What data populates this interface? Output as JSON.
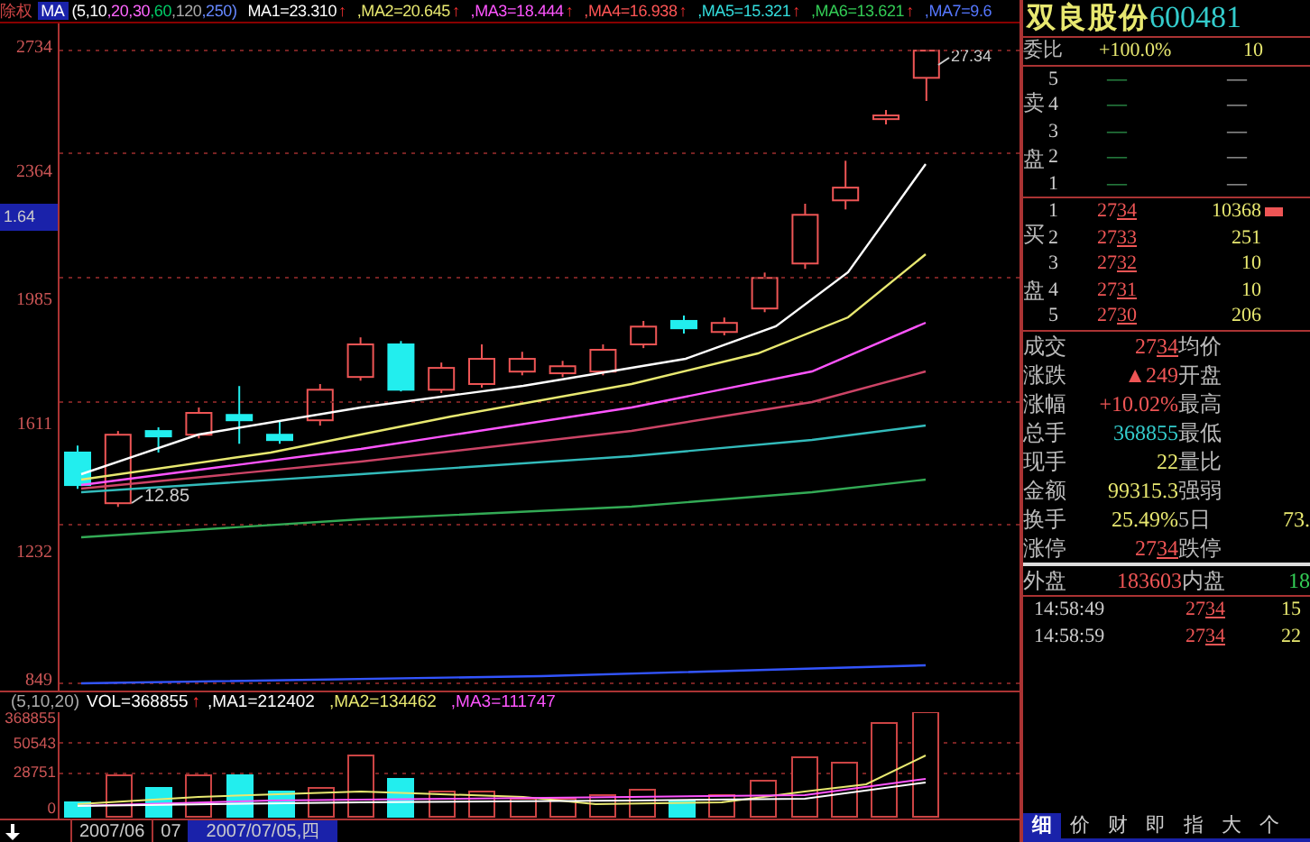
{
  "indicator_bar": {
    "label": "除权",
    "ma_title": "MA",
    "ma_periods": [
      {
        "text": "(5",
        "color": "#ffffff"
      },
      {
        "text": ",10",
        "color": "#ffffff"
      },
      {
        "text": ",20",
        "color": "#ff66ff"
      },
      {
        "text": ",30",
        "color": "#ff66ff"
      },
      {
        "text": ",60",
        "color": "#00cc66"
      },
      {
        "text": ",120",
        "color": "#aaaaaa"
      },
      {
        "text": ",250)",
        "color": "#6688ff"
      }
    ],
    "items": [
      {
        "text": "MA1=23.310",
        "arrow": "↑",
        "color": "#ffffff"
      },
      {
        "text": ",MA2=20.645",
        "arrow": "↑",
        "color": "#e8e870"
      },
      {
        "text": ",MA3=18.444",
        "arrow": "↑",
        "color": "#ff55ff"
      },
      {
        "text": ",MA4=16.938",
        "arrow": "↑",
        "color": "#ff5555"
      },
      {
        "text": ",MA5=15.321",
        "arrow": "↑",
        "color": "#33dddd"
      },
      {
        "text": ",MA6=13.621",
        "arrow": "↑",
        "color": "#33cc55"
      },
      {
        "text": ",MA7=9.6",
        "color": "#5577ff"
      }
    ]
  },
  "price_axis": {
    "cursor_value": "1.64"
  },
  "price_chart": {
    "high_label": "27.34",
    "low_label": "12.85",
    "chart_data": {
      "type": "candlestick",
      "ylim": [
        828,
        2815
      ],
      "yticks": [
        2734,
        2364,
        1985,
        1611,
        1232,
        849
      ],
      "ohlc": [
        [
          1537,
          1558,
          1429,
          1440
        ],
        [
          1386,
          1601,
          1375,
          1590
        ],
        [
          1601,
          1612,
          1537,
          1585
        ],
        [
          1590,
          1671,
          1579,
          1655
        ],
        [
          1649,
          1735,
          1563,
          1633
        ],
        [
          1590,
          1633,
          1563,
          1574
        ],
        [
          1633,
          1741,
          1617,
          1724
        ],
        [
          1762,
          1880,
          1751,
          1859
        ],
        [
          1859,
          1869,
          1719,
          1724
        ],
        [
          1724,
          1805,
          1714,
          1789
        ],
        [
          1741,
          1859,
          1730,
          1816
        ],
        [
          1778,
          1837,
          1767,
          1816
        ],
        [
          1773,
          1810,
          1762,
          1794
        ],
        [
          1778,
          1859,
          1767,
          1843
        ],
        [
          1859,
          1929,
          1848,
          1912
        ],
        [
          1929,
          1945,
          1891,
          1907
        ],
        [
          1896,
          1939,
          1886,
          1923
        ],
        [
          1966,
          2073,
          1955,
          2057
        ],
        [
          2100,
          2278,
          2084,
          2245
        ],
        [
          2288,
          2406,
          2261,
          2326
        ],
        [
          2530,
          2557,
          2514,
          2541
        ],
        [
          2653,
          2734,
          2584,
          2734
        ]
      ]
    }
  },
  "volume_bar": {
    "params": "(5,10,20)",
    "items": [
      {
        "text": "VOL=368855",
        "arrow": "↑",
        "color": "#ffffff"
      },
      {
        "text": ",MA1=212402",
        "color": "#ffffff"
      },
      {
        "text": ",MA2=134462",
        "color": "#e8e870"
      },
      {
        "text": ",MA3=111747",
        "color": "#ff55ff"
      }
    ]
  },
  "volume_axis": [
    "368855",
    "50543",
    "28751",
    "0"
  ],
  "date_bar": {
    "dates": [
      "2007/06",
      "07"
    ],
    "cursor_date": "2007/07/05,四"
  },
  "quote": {
    "name": "双良股份",
    "code": "600481",
    "ratio": {
      "label": "委比",
      "value": "+100.0%",
      "extra": "10"
    },
    "sell": {
      "label": "卖盘",
      "rows": [
        {
          "rank": "5",
          "price": "—",
          "volume": "—"
        },
        {
          "rank": "4",
          "price": "—",
          "volume": "—"
        },
        {
          "rank": "3",
          "price": "—",
          "volume": "—"
        },
        {
          "rank": "2",
          "price": "—",
          "volume": "—"
        },
        {
          "rank": "1",
          "price": "—",
          "volume": "—"
        }
      ]
    },
    "buy": {
      "label": "买盘",
      "rows": [
        {
          "rank": "1",
          "price": "2734",
          "volume": "10368",
          "highlight": true
        },
        {
          "rank": "2",
          "price": "2733",
          "volume": "251",
          "highlight": false
        },
        {
          "rank": "3",
          "price": "2732",
          "volume": "10",
          "highlight": false
        },
        {
          "rank": "4",
          "price": "2731",
          "volume": "10",
          "highlight": false
        },
        {
          "rank": "5",
          "price": "2730",
          "volume": "206",
          "highlight": false
        }
      ]
    },
    "stats": [
      {
        "label": "成交",
        "value": "2734",
        "kind": "price",
        "label2": "均价"
      },
      {
        "label": "涨跌",
        "value": "▲249",
        "kind": "change",
        "label2": "开盘"
      },
      {
        "label": "涨幅",
        "value": "+10.02%",
        "kind": "change",
        "label2": "最高"
      },
      {
        "label": "总手",
        "value": "368855",
        "kind": "volume",
        "label2": "最低"
      },
      {
        "label": "现手",
        "value": "22",
        "kind": "plain",
        "label2": "量比"
      },
      {
        "label": "金额",
        "value": "99315.3",
        "kind": "plain",
        "label2": "强弱"
      },
      {
        "label": "换手",
        "value": "25.49%",
        "kind": "plain",
        "label2": "5日",
        "value2": "73."
      },
      {
        "label": "涨停",
        "value": "2734",
        "kind": "price",
        "label2": "跌停"
      }
    ],
    "outer": {
      "label": "外盘",
      "value": "183603",
      "label2": "内盘",
      "value2": "18"
    },
    "trades": [
      {
        "time": "14:58:49",
        "price": "2734",
        "volume": "15"
      },
      {
        "time": "14:58:59",
        "price": "2734",
        "volume": "22"
      }
    ],
    "tabs": [
      {
        "label": "细",
        "selected": true
      },
      {
        "label": "价",
        "selected": false
      },
      {
        "label": "财",
        "selected": false
      },
      {
        "label": "即",
        "selected": false
      },
      {
        "label": "指",
        "selected": false
      },
      {
        "label": "大",
        "selected": false
      },
      {
        "label": "个",
        "selected": false
      }
    ]
  }
}
